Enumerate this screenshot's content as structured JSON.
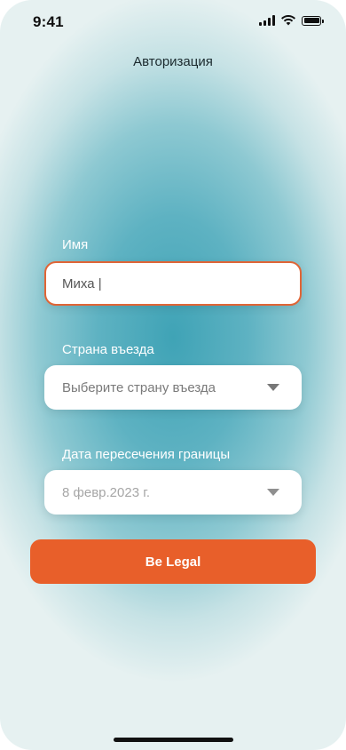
{
  "status_bar": {
    "time": "9:41"
  },
  "header": {
    "title": "Авторизация"
  },
  "form": {
    "name": {
      "label": "Имя",
      "value": "Миха |"
    },
    "country": {
      "label": "Страна въезда",
      "placeholder": "Выберите страну въезда"
    },
    "date": {
      "label": "Дата пересечения границы",
      "value": "8 февр.2023 г."
    }
  },
  "actions": {
    "submit_label": "Be Legal"
  },
  "colors": {
    "accent": "#e85f2a",
    "focus_border": "#e06536",
    "background_center": "#3fa3b6"
  }
}
